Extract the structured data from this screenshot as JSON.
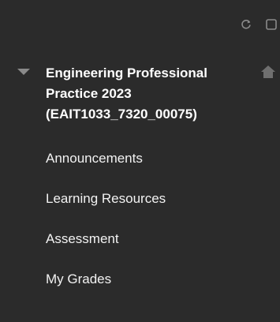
{
  "toolbar": {
    "icons": [
      "refresh-icon",
      "square-icon"
    ]
  },
  "course": {
    "title_line1": "Engineering Professional",
    "title_line2": "Practice 2023",
    "title_line3": "(EAIT1033_7320_00075)",
    "expanded": true
  },
  "menu": {
    "items": [
      {
        "label": "Announcements"
      },
      {
        "label": "Learning Resources"
      },
      {
        "label": "Assessment"
      },
      {
        "label": "My Grades"
      }
    ]
  },
  "colors": {
    "background": "#2b2b2b",
    "text": "#ffffff",
    "icon": "#8a8a8a"
  }
}
